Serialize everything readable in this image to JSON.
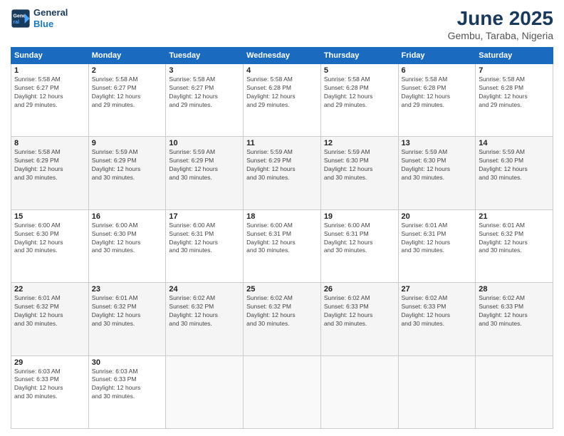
{
  "header": {
    "logo_line1": "General",
    "logo_line2": "Blue",
    "title": "June 2025",
    "subtitle": "Gembu, Taraba, Nigeria"
  },
  "calendar": {
    "days_of_week": [
      "Sunday",
      "Monday",
      "Tuesday",
      "Wednesday",
      "Thursday",
      "Friday",
      "Saturday"
    ],
    "weeks": [
      [
        {
          "day": "1",
          "info": "Sunrise: 5:58 AM\nSunset: 6:27 PM\nDaylight: 12 hours\nand 29 minutes."
        },
        {
          "day": "2",
          "info": "Sunrise: 5:58 AM\nSunset: 6:27 PM\nDaylight: 12 hours\nand 29 minutes."
        },
        {
          "day": "3",
          "info": "Sunrise: 5:58 AM\nSunset: 6:27 PM\nDaylight: 12 hours\nand 29 minutes."
        },
        {
          "day": "4",
          "info": "Sunrise: 5:58 AM\nSunset: 6:28 PM\nDaylight: 12 hours\nand 29 minutes."
        },
        {
          "day": "5",
          "info": "Sunrise: 5:58 AM\nSunset: 6:28 PM\nDaylight: 12 hours\nand 29 minutes."
        },
        {
          "day": "6",
          "info": "Sunrise: 5:58 AM\nSunset: 6:28 PM\nDaylight: 12 hours\nand 29 minutes."
        },
        {
          "day": "7",
          "info": "Sunrise: 5:58 AM\nSunset: 6:28 PM\nDaylight: 12 hours\nand 29 minutes."
        }
      ],
      [
        {
          "day": "8",
          "info": "Sunrise: 5:58 AM\nSunset: 6:29 PM\nDaylight: 12 hours\nand 30 minutes."
        },
        {
          "day": "9",
          "info": "Sunrise: 5:59 AM\nSunset: 6:29 PM\nDaylight: 12 hours\nand 30 minutes."
        },
        {
          "day": "10",
          "info": "Sunrise: 5:59 AM\nSunset: 6:29 PM\nDaylight: 12 hours\nand 30 minutes."
        },
        {
          "day": "11",
          "info": "Sunrise: 5:59 AM\nSunset: 6:29 PM\nDaylight: 12 hours\nand 30 minutes."
        },
        {
          "day": "12",
          "info": "Sunrise: 5:59 AM\nSunset: 6:30 PM\nDaylight: 12 hours\nand 30 minutes."
        },
        {
          "day": "13",
          "info": "Sunrise: 5:59 AM\nSunset: 6:30 PM\nDaylight: 12 hours\nand 30 minutes."
        },
        {
          "day": "14",
          "info": "Sunrise: 5:59 AM\nSunset: 6:30 PM\nDaylight: 12 hours\nand 30 minutes."
        }
      ],
      [
        {
          "day": "15",
          "info": "Sunrise: 6:00 AM\nSunset: 6:30 PM\nDaylight: 12 hours\nand 30 minutes."
        },
        {
          "day": "16",
          "info": "Sunrise: 6:00 AM\nSunset: 6:30 PM\nDaylight: 12 hours\nand 30 minutes."
        },
        {
          "day": "17",
          "info": "Sunrise: 6:00 AM\nSunset: 6:31 PM\nDaylight: 12 hours\nand 30 minutes."
        },
        {
          "day": "18",
          "info": "Sunrise: 6:00 AM\nSunset: 6:31 PM\nDaylight: 12 hours\nand 30 minutes."
        },
        {
          "day": "19",
          "info": "Sunrise: 6:00 AM\nSunset: 6:31 PM\nDaylight: 12 hours\nand 30 minutes."
        },
        {
          "day": "20",
          "info": "Sunrise: 6:01 AM\nSunset: 6:31 PM\nDaylight: 12 hours\nand 30 minutes."
        },
        {
          "day": "21",
          "info": "Sunrise: 6:01 AM\nSunset: 6:32 PM\nDaylight: 12 hours\nand 30 minutes."
        }
      ],
      [
        {
          "day": "22",
          "info": "Sunrise: 6:01 AM\nSunset: 6:32 PM\nDaylight: 12 hours\nand 30 minutes."
        },
        {
          "day": "23",
          "info": "Sunrise: 6:01 AM\nSunset: 6:32 PM\nDaylight: 12 hours\nand 30 minutes."
        },
        {
          "day": "24",
          "info": "Sunrise: 6:02 AM\nSunset: 6:32 PM\nDaylight: 12 hours\nand 30 minutes."
        },
        {
          "day": "25",
          "info": "Sunrise: 6:02 AM\nSunset: 6:32 PM\nDaylight: 12 hours\nand 30 minutes."
        },
        {
          "day": "26",
          "info": "Sunrise: 6:02 AM\nSunset: 6:33 PM\nDaylight: 12 hours\nand 30 minutes."
        },
        {
          "day": "27",
          "info": "Sunrise: 6:02 AM\nSunset: 6:33 PM\nDaylight: 12 hours\nand 30 minutes."
        },
        {
          "day": "28",
          "info": "Sunrise: 6:02 AM\nSunset: 6:33 PM\nDaylight: 12 hours\nand 30 minutes."
        }
      ],
      [
        {
          "day": "29",
          "info": "Sunrise: 6:03 AM\nSunset: 6:33 PM\nDaylight: 12 hours\nand 30 minutes."
        },
        {
          "day": "30",
          "info": "Sunrise: 6:03 AM\nSunset: 6:33 PM\nDaylight: 12 hours\nand 30 minutes."
        },
        {
          "day": "",
          "info": ""
        },
        {
          "day": "",
          "info": ""
        },
        {
          "day": "",
          "info": ""
        },
        {
          "day": "",
          "info": ""
        },
        {
          "day": "",
          "info": ""
        }
      ]
    ]
  }
}
